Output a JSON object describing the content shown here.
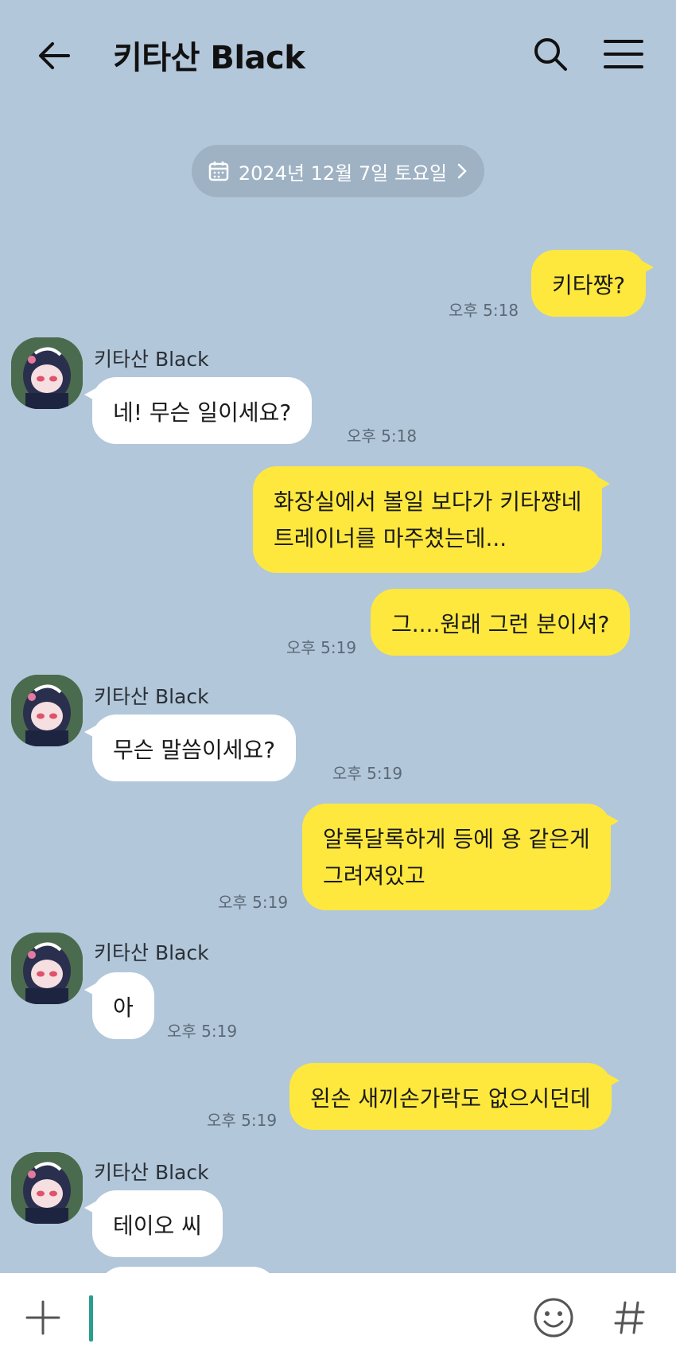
{
  "header": {
    "title": "키타산 Black",
    "back_icon": "arrow-left-icon",
    "search_icon": "search-icon",
    "menu_icon": "menu-icon"
  },
  "date_divider": {
    "label": "2024년 12월 7일 토요일"
  },
  "messages": [
    {
      "from": "me",
      "lines": [
        "키타쨩?"
      ],
      "time": "오후 5:18"
    },
    {
      "from": "them",
      "sender": "키타산 Black",
      "lines": [
        "네! 무슨 일이세요?"
      ],
      "time": "오후 5:18"
    },
    {
      "from": "me",
      "lines": [
        "화장실에서 볼일 보다가 키타쨩네",
        "트레이너를 마주쳤는데..."
      ],
      "time": ""
    },
    {
      "from": "me",
      "lines": [
        "그....원래 그런 분이셔?"
      ],
      "time": "오후 5:19"
    },
    {
      "from": "them",
      "sender": "키타산 Black",
      "lines": [
        "무슨 말씀이세요?"
      ],
      "time": "오후 5:19"
    },
    {
      "from": "me",
      "lines": [
        "알록달록하게 등에 용 같은게",
        "그려져있고"
      ],
      "time": "오후 5:19"
    },
    {
      "from": "them",
      "sender": "키타산 Black",
      "lines": [
        "아"
      ],
      "time": "오후 5:19"
    },
    {
      "from": "me",
      "lines": [
        "왼손 새끼손가락도 없으시던데"
      ],
      "time": "오후 5:19"
    },
    {
      "from": "them",
      "sender": "키타산 Black",
      "lines": [
        "테이오 씨"
      ],
      "time": ""
    }
  ],
  "input": {
    "value": "",
    "plus_icon": "plus-icon",
    "emoji_icon": "emoji-icon",
    "hash_icon": "hash-icon"
  },
  "colors": {
    "background": "#b2c7da",
    "my_bubble": "#fee83e",
    "their_bubble": "#ffffff"
  }
}
